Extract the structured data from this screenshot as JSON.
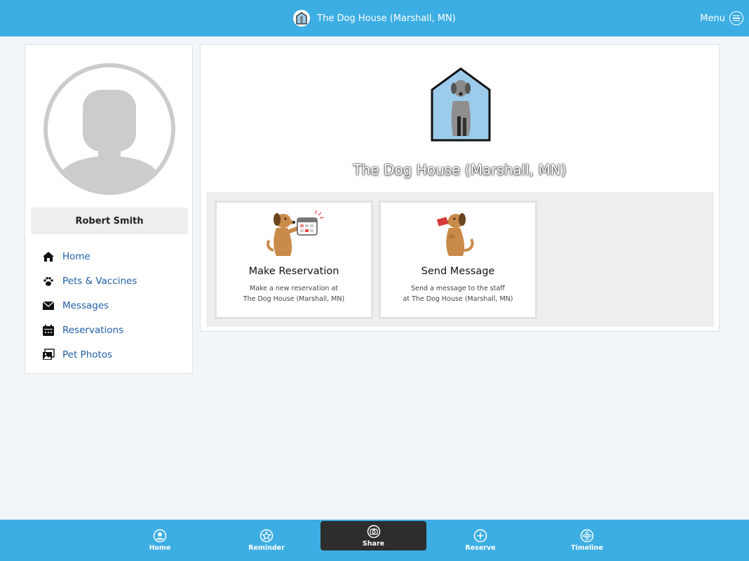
{
  "header": {
    "title": "The Dog House (Marshall, MN)",
    "menu_label": "Menu"
  },
  "sidebar": {
    "user_name": "Robert Smith",
    "items": [
      {
        "label": "Home",
        "icon": "home-icon"
      },
      {
        "label": "Pets & Vaccines",
        "icon": "paw-icon"
      },
      {
        "label": "Messages",
        "icon": "envelope-icon"
      },
      {
        "label": "Reservations",
        "icon": "calendar-icon"
      },
      {
        "label": "Pet Photos",
        "icon": "photos-icon"
      }
    ]
  },
  "main": {
    "facility_name": "The Dog House (Marshall, MN)",
    "cards": [
      {
        "title": "Make Reservation",
        "desc_line1": "Make a new reservation at",
        "desc_line2": "The Dog House (Marshall, MN)"
      },
      {
        "title": "Send Message",
        "desc_line1": "Send a message to the staff",
        "desc_line2": "at The Dog House (Marshall, MN)"
      }
    ]
  },
  "tabbar": {
    "tabs": [
      {
        "label": "Home",
        "icon": "user-circle-icon"
      },
      {
        "label": "Reminder",
        "icon": "star-icon"
      },
      {
        "label": "Share",
        "icon": "camera-icon",
        "active": true
      },
      {
        "label": "Reserve",
        "icon": "plus-circle-icon"
      },
      {
        "label": "Timeline",
        "icon": "timeline-icon"
      }
    ]
  },
  "colors": {
    "brand": "#3daee3",
    "link": "#1f5fa6",
    "active_tab": "#2d2d2d"
  }
}
